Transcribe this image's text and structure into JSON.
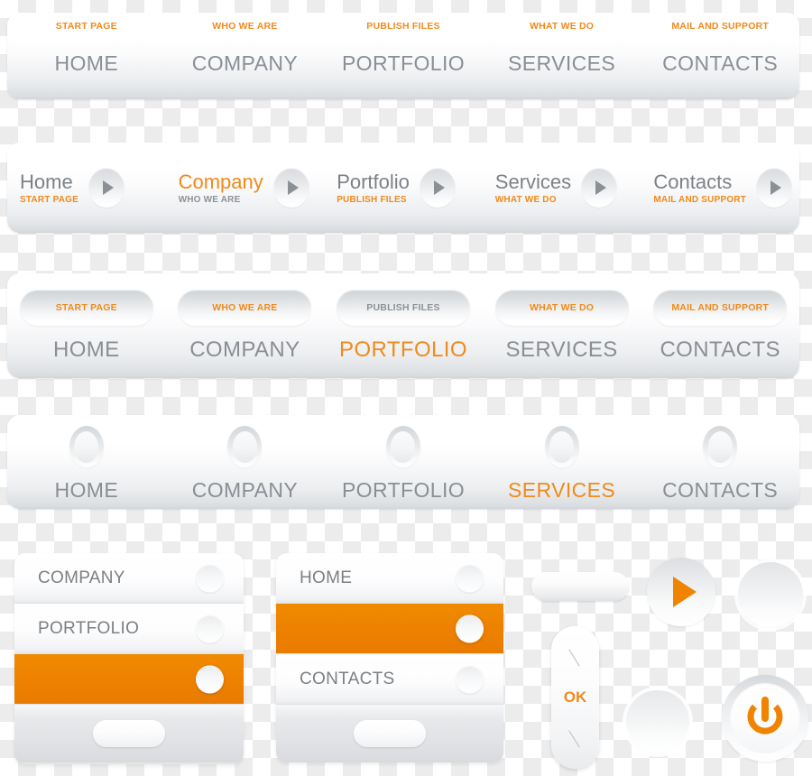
{
  "palette": {
    "accent_orange": "#f08a1c",
    "row_orange": "#ee8000",
    "label_grey": "#8a8f95",
    "panel_grey": "#e3e5e7",
    "checker_grey": "#ececec"
  },
  "navbar_1": {
    "items": [
      {
        "sublabel": "START PAGE",
        "label": "HOME",
        "sub_color": "orange",
        "label_color": "grey"
      },
      {
        "sublabel": "WHO WE ARE",
        "label": "COMPANY",
        "sub_color": "orange",
        "label_color": "grey"
      },
      {
        "sublabel": "PUBLISH FILES",
        "label": "PORTFOLIO",
        "sub_color": "orange",
        "label_color": "grey"
      },
      {
        "sublabel": "WHAT WE DO",
        "label": "SERVICES",
        "sub_color": "orange",
        "label_color": "grey"
      },
      {
        "sublabel": "MAIL AND SUPPORT",
        "label": "CONTACTS",
        "sub_color": "orange",
        "label_color": "grey"
      }
    ]
  },
  "navbar_2": {
    "arrow_icon": "play-triangle-icon",
    "items": [
      {
        "label": "Home",
        "sublabel": "START PAGE",
        "label_color": "grey",
        "sub_color": "orange"
      },
      {
        "label": "Company",
        "sublabel": "WHO WE ARE",
        "label_color": "orange",
        "sub_color": "grey"
      },
      {
        "label": "Portfolio",
        "sublabel": "PUBLISH FILES",
        "label_color": "grey",
        "sub_color": "orange"
      },
      {
        "label": "Services",
        "sublabel": "WHAT WE DO",
        "label_color": "grey",
        "sub_color": "orange"
      },
      {
        "label": "Contacts",
        "sublabel": "MAIL AND SUPPORT",
        "label_color": "grey",
        "sub_color": "orange"
      }
    ]
  },
  "navbar_3": {
    "items": [
      {
        "sublabel": "START PAGE",
        "label": "HOME",
        "sub_color": "orange",
        "label_color": "grey"
      },
      {
        "sublabel": "WHO WE ARE",
        "label": "COMPANY",
        "sub_color": "orange",
        "label_color": "grey"
      },
      {
        "sublabel": "PUBLISH FILES",
        "label": "PORTFOLIO",
        "sub_color": "grey",
        "label_color": "orange"
      },
      {
        "sublabel": "WHAT WE DO",
        "label": "SERVICES",
        "sub_color": "orange",
        "label_color": "grey"
      },
      {
        "sublabel": "MAIL AND SUPPORT",
        "label": "CONTACTS",
        "sub_color": "orange",
        "label_color": "grey"
      }
    ]
  },
  "navbar_4": {
    "icon": "oval-ring-icon",
    "items": [
      {
        "label": "HOME",
        "label_color": "grey"
      },
      {
        "label": "COMPANY",
        "label_color": "grey"
      },
      {
        "label": "PORTFOLIO",
        "label_color": "grey"
      },
      {
        "label": "SERVICES",
        "label_color": "orange"
      },
      {
        "label": "CONTACTS",
        "label_color": "grey"
      }
    ]
  },
  "panel_1": {
    "rows": [
      {
        "label": "COMPANY",
        "on": false
      },
      {
        "label": "PORTFOLIO",
        "on": false
      },
      {
        "label": "",
        "on": true
      }
    ],
    "footer_button_label": ""
  },
  "panel_2": {
    "rows": [
      {
        "label": "HOME",
        "on": false
      },
      {
        "label": "",
        "on": true
      },
      {
        "label": "CONTACTS",
        "on": false
      }
    ],
    "footer_button_label": ""
  },
  "controls": {
    "pill_button": {
      "name": "pill-button",
      "label": ""
    },
    "play_button": {
      "name": "play-button",
      "icon": "play-triangle-icon",
      "label": ""
    },
    "circle_button_top": {
      "name": "circle-button",
      "label": ""
    },
    "ok_slider": {
      "name": "ok-slider",
      "label": "OK",
      "mark_icon": "slash-mark-icon"
    },
    "circle_button_bottom": {
      "name": "circle-button",
      "label": ""
    },
    "power_button": {
      "name": "power-button",
      "icon": "power-icon",
      "label": ""
    }
  }
}
